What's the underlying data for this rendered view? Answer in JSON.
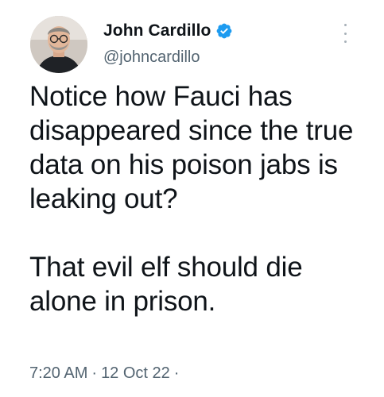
{
  "author": {
    "name": "John Cardillo",
    "handle": "@johncardillo",
    "verified": true,
    "avatar_icon": "profile-photo",
    "verified_icon": "verified-badge-icon",
    "verified_color": "#1d9bf0"
  },
  "tweet": {
    "paragraphs": [
      "Notice how Fauci has disappeared since the true data on his poison jabs is leaking out?",
      "That evil elf should die alone in prison."
    ]
  },
  "meta": {
    "time": "7:20 AM",
    "separator": "·",
    "date": "12 Oct 22",
    "trailing_separator": "·"
  },
  "colors": {
    "text": "#0f1419",
    "secondary": "#536471",
    "background": "#ffffff"
  }
}
